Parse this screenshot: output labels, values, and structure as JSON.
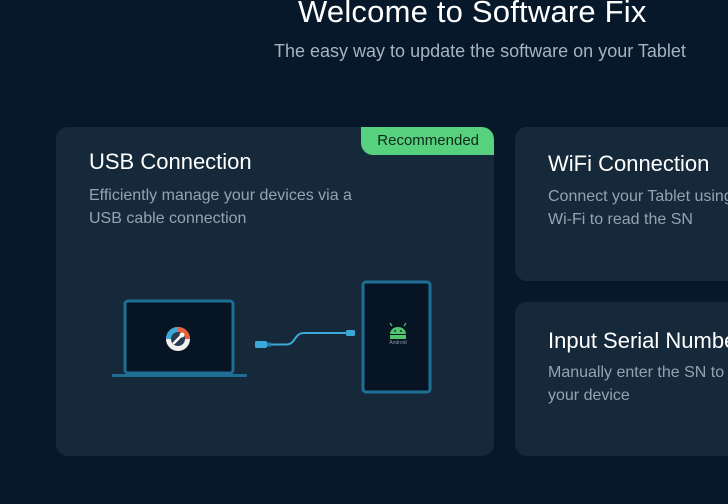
{
  "header": {
    "title": "Welcome to Software Fix",
    "subtitle": "The easy way to update the software on your Tablet"
  },
  "cards": {
    "usb": {
      "badge": "Recommended",
      "title": "USB Connection",
      "desc_line1": "Efficiently manage your devices  via a",
      "desc_line2": "USB cable connection",
      "tablet_label": "Android"
    },
    "wifi": {
      "title": "WiFi Connection",
      "desc_line1": "Connect your Tablet using",
      "desc_line2": "Wi-Fi to read the SN"
    },
    "serial": {
      "title": "Input Serial Number",
      "desc_line1": "Manually enter the SN to",
      "desc_line2": "your device"
    }
  },
  "colors": {
    "background": "#061829",
    "card": "#16293b",
    "badge": "#58d17e",
    "accent": "#3aa8d8"
  }
}
